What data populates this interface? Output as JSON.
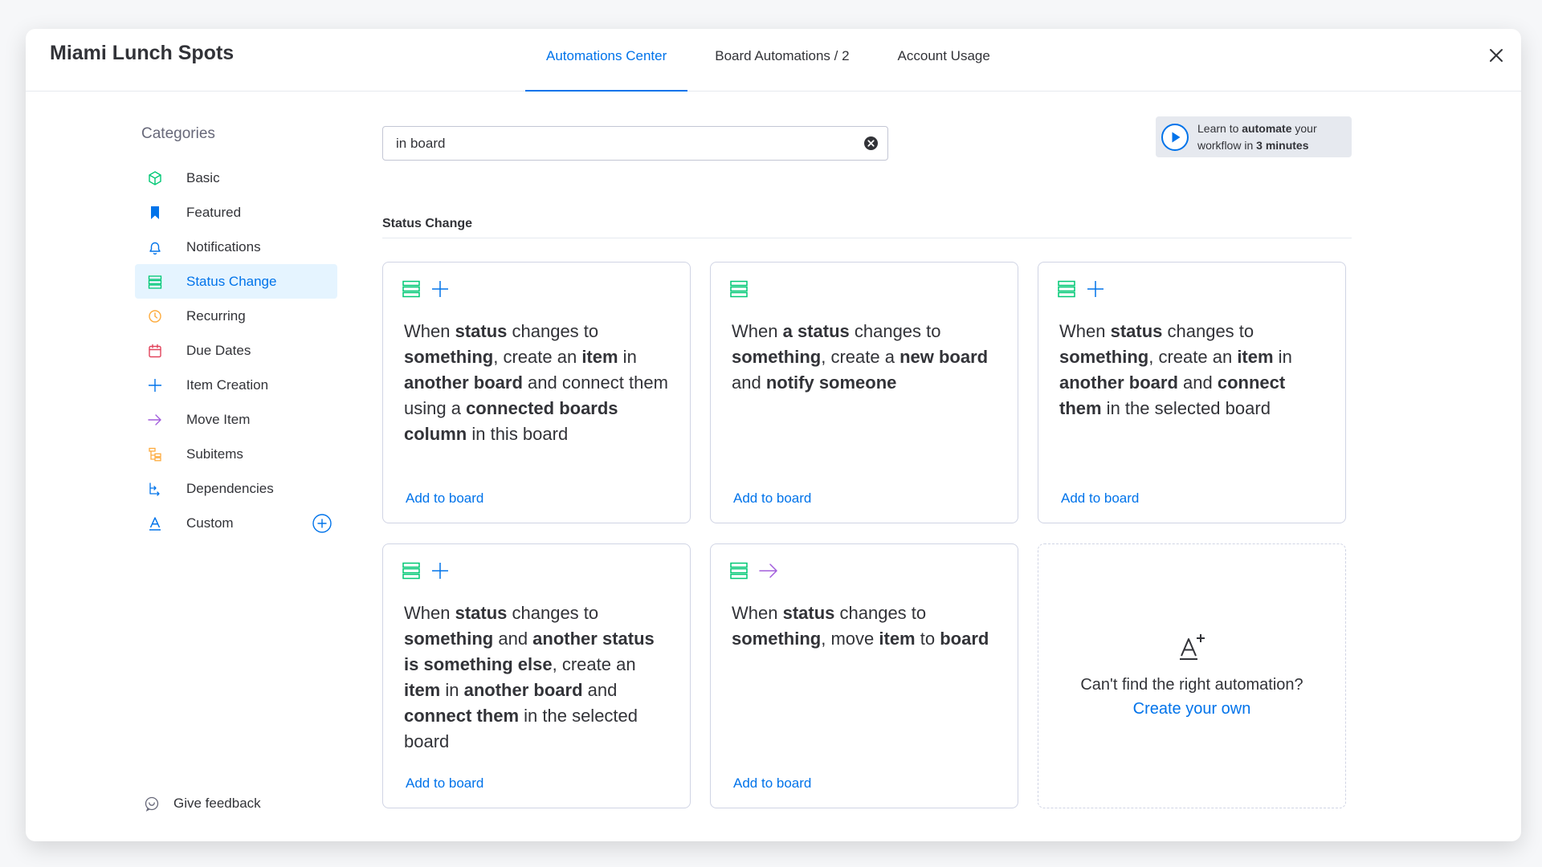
{
  "header": {
    "title": "Miami Lunch Spots",
    "tabs": [
      {
        "label": "Automations Center",
        "active": true
      },
      {
        "label": "Board Automations / 2",
        "active": false
      },
      {
        "label": "Account Usage",
        "active": false
      }
    ]
  },
  "sidebar": {
    "title": "Categories",
    "items": [
      {
        "label": "Basic",
        "icon": "cube-icon",
        "color": "#00c875"
      },
      {
        "label": "Featured",
        "icon": "bookmark-icon",
        "color": "#0073ea"
      },
      {
        "label": "Notifications",
        "icon": "bell-icon",
        "color": "#0073ea"
      },
      {
        "label": "Status Change",
        "icon": "status-columns-icon",
        "color": "#00c875"
      },
      {
        "label": "Recurring",
        "icon": "clock-icon",
        "color": "#fdab3d"
      },
      {
        "label": "Due Dates",
        "icon": "calendar-icon",
        "color": "#e2445c"
      },
      {
        "label": "Item Creation",
        "icon": "plus-icon",
        "color": "#0073ea"
      },
      {
        "label": "Move Item",
        "icon": "arrow-right-icon",
        "color": "#a25ddc"
      },
      {
        "label": "Subitems",
        "icon": "subitems-icon",
        "color": "#fdab3d"
      },
      {
        "label": "Dependencies",
        "icon": "dependencies-icon",
        "color": "#0073ea"
      },
      {
        "label": "Custom",
        "icon": "custom-text-icon",
        "color": "#0073ea"
      }
    ],
    "active_index": 3,
    "feedback_label": "Give feedback"
  },
  "search": {
    "value": "in board"
  },
  "learn": {
    "prefix": "Learn to ",
    "bold1": "automate",
    "mid": " your workflow in ",
    "bold2": "3 minutes"
  },
  "section": {
    "title": "Status Change"
  },
  "cards": [
    {
      "icons": [
        "status-columns-icon",
        "plus-icon"
      ],
      "segments": [
        {
          "t": "When ",
          "b": false
        },
        {
          "t": "status",
          "b": true
        },
        {
          "t": " changes to ",
          "b": false
        },
        {
          "t": "something",
          "b": true
        },
        {
          "t": ", create an ",
          "b": false
        },
        {
          "t": "item",
          "b": true
        },
        {
          "t": " in ",
          "b": false
        },
        {
          "t": "another board",
          "b": true
        },
        {
          "t": " and connect them using a ",
          "b": false
        },
        {
          "t": "connected boards column",
          "b": true
        },
        {
          "t": " in this board",
          "b": false
        }
      ],
      "link": "Add to board"
    },
    {
      "icons": [
        "status-columns-icon"
      ],
      "segments": [
        {
          "t": "When ",
          "b": false
        },
        {
          "t": "a status",
          "b": true
        },
        {
          "t": " changes to ",
          "b": false
        },
        {
          "t": "something",
          "b": true
        },
        {
          "t": ", create a ",
          "b": false
        },
        {
          "t": "new board",
          "b": true
        },
        {
          "t": " and ",
          "b": false
        },
        {
          "t": "notify someone",
          "b": true
        }
      ],
      "link": "Add to board"
    },
    {
      "icons": [
        "status-columns-icon",
        "plus-icon"
      ],
      "segments": [
        {
          "t": "When ",
          "b": false
        },
        {
          "t": "status",
          "b": true
        },
        {
          "t": " changes to ",
          "b": false
        },
        {
          "t": "something",
          "b": true
        },
        {
          "t": ", create an ",
          "b": false
        },
        {
          "t": "item",
          "b": true
        },
        {
          "t": " in ",
          "b": false
        },
        {
          "t": "another board",
          "b": true
        },
        {
          "t": " and ",
          "b": false
        },
        {
          "t": "connect them",
          "b": true
        },
        {
          "t": " in the selected board",
          "b": false
        }
      ],
      "link": "Add to board"
    },
    {
      "icons": [
        "status-columns-icon",
        "plus-icon"
      ],
      "segments": [
        {
          "t": "When ",
          "b": false
        },
        {
          "t": "status",
          "b": true
        },
        {
          "t": " changes to ",
          "b": false
        },
        {
          "t": "something",
          "b": true
        },
        {
          "t": " and ",
          "b": false
        },
        {
          "t": "another status is something else",
          "b": true
        },
        {
          "t": ", create an ",
          "b": false
        },
        {
          "t": "item",
          "b": true
        },
        {
          "t": " in ",
          "b": false
        },
        {
          "t": "another board",
          "b": true
        },
        {
          "t": " and ",
          "b": false
        },
        {
          "t": "connect them",
          "b": true
        },
        {
          "t": " in the selected board",
          "b": false
        }
      ],
      "link": "Add to board"
    },
    {
      "icons": [
        "status-columns-icon",
        "arrow-right-icon"
      ],
      "segments": [
        {
          "t": "When ",
          "b": false
        },
        {
          "t": "status",
          "b": true
        },
        {
          "t": " changes to ",
          "b": false
        },
        {
          "t": "something",
          "b": true
        },
        {
          "t": ", move ",
          "b": false
        },
        {
          "t": "item",
          "b": true
        },
        {
          "t": " to ",
          "b": false
        },
        {
          "t": "board",
          "b": true
        }
      ],
      "link": "Add to board"
    }
  ],
  "custom_card": {
    "icon": "custom-automation-icon",
    "question": "Can't find the right automation?",
    "link": "Create your own"
  },
  "colors": {
    "accent": "#0073ea",
    "green": "#00c875",
    "purple": "#a25ddc",
    "active_bg": "#e5f4ff"
  }
}
